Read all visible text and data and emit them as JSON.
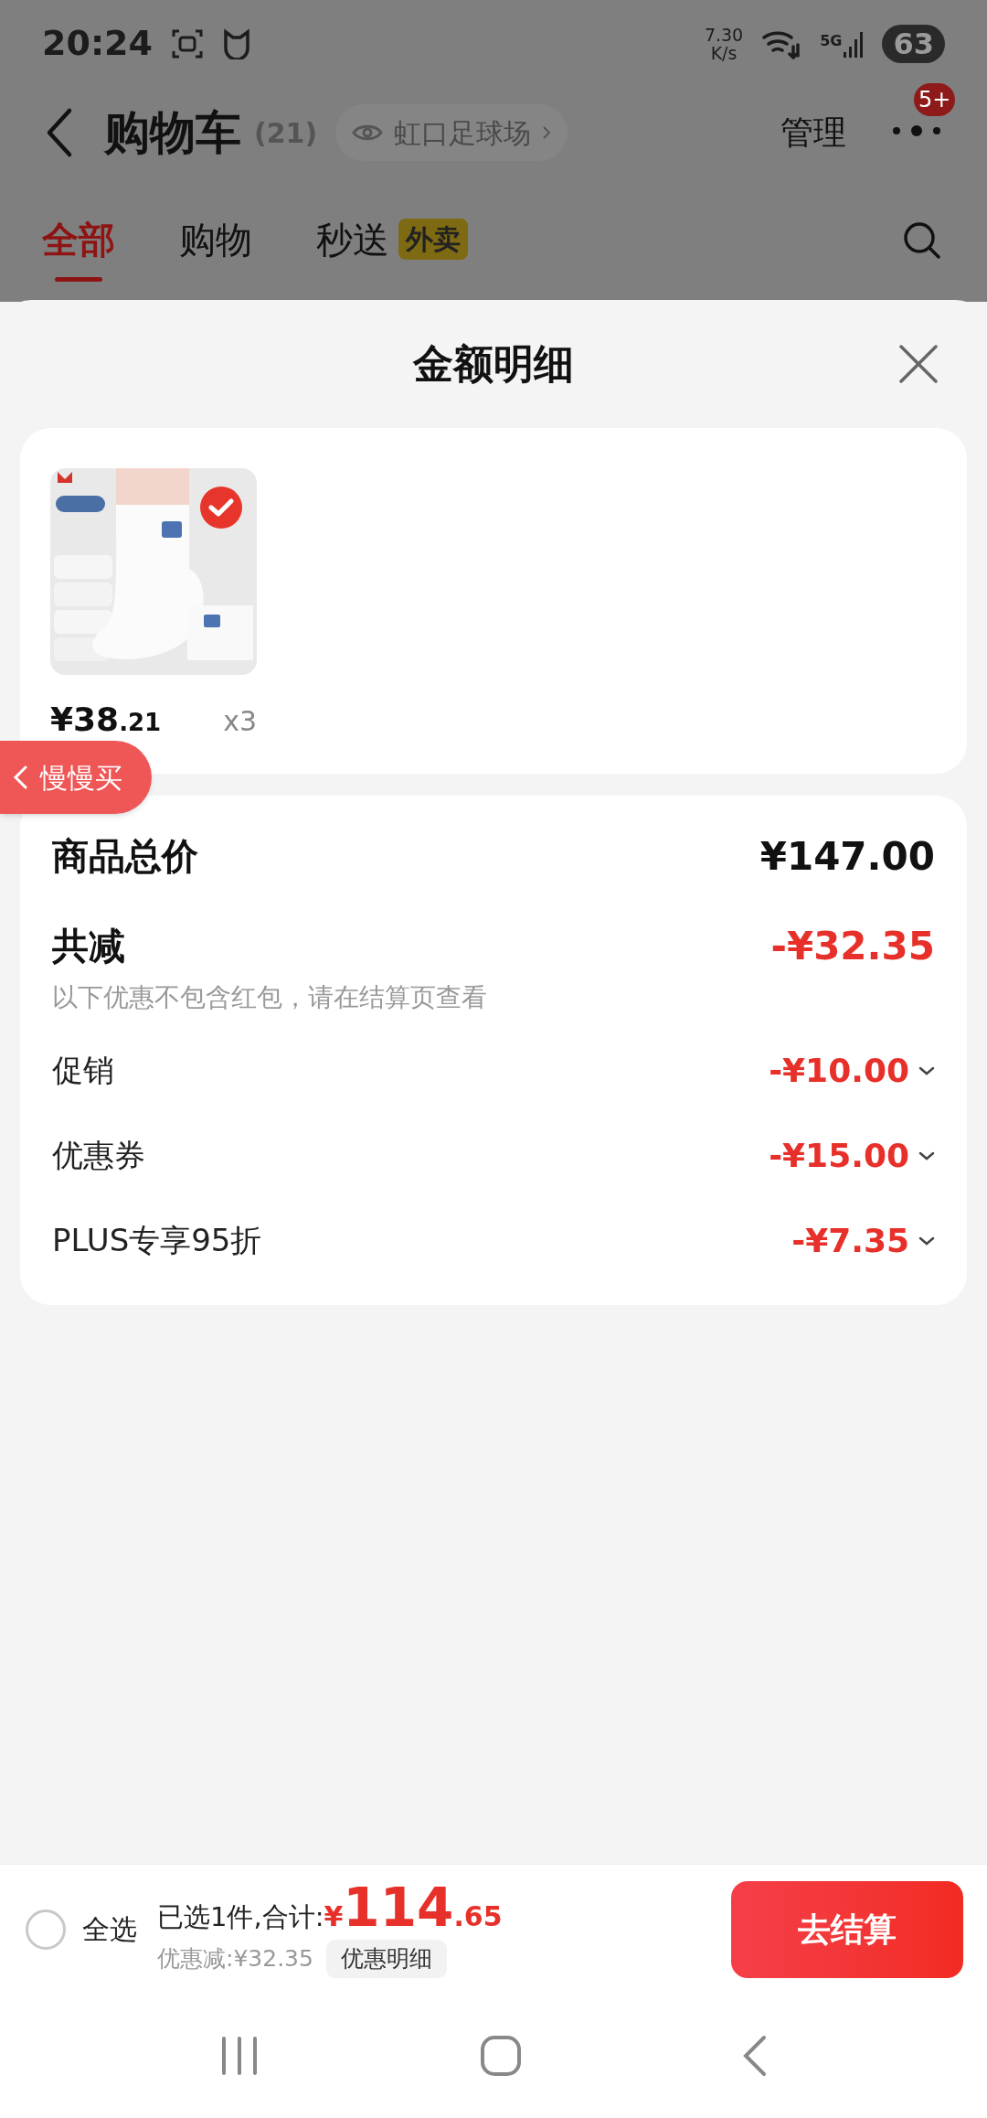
{
  "status_bar": {
    "time": "20:24",
    "speed": "7.30",
    "speed_unit": "K/s",
    "network": "5G",
    "battery": "63"
  },
  "header": {
    "title": "购物车",
    "count": "(21)",
    "location": "虹口足球场",
    "manage": "管理",
    "badge": "5+"
  },
  "tabs": [
    {
      "label": "全部",
      "selected": true
    },
    {
      "label": "购物",
      "selected": false
    },
    {
      "label": "秒送",
      "selected": false,
      "tag": "外卖"
    }
  ],
  "sheet": {
    "title": "金额明细",
    "product": {
      "kind": "picture",
      "selected": true,
      "price_int": "¥38",
      "price_dec": ".21",
      "quantity": "x3"
    },
    "float_button": "慢慢买",
    "total": {
      "label": "商品总价",
      "value": "¥147.00"
    },
    "reduction": {
      "label": "共减",
      "value": "-¥32.35",
      "note": "以下优惠不包含红包，请在结算页查看"
    },
    "discounts": [
      {
        "label": "促销",
        "value": "-¥10.00"
      },
      {
        "label": "优惠券",
        "value": "-¥15.00"
      },
      {
        "label": "PLUS专享95折",
        "value": "-¥7.35"
      }
    ]
  },
  "bottom_bar": {
    "select_all": {
      "label": "全选",
      "checked": false
    },
    "summary": "已选1件,合计:",
    "currency": "¥",
    "total_int": "114",
    "total_dec": ".65",
    "discount": "优惠减:¥32.35",
    "detail_button": "优惠明细",
    "checkout": "去结算"
  }
}
